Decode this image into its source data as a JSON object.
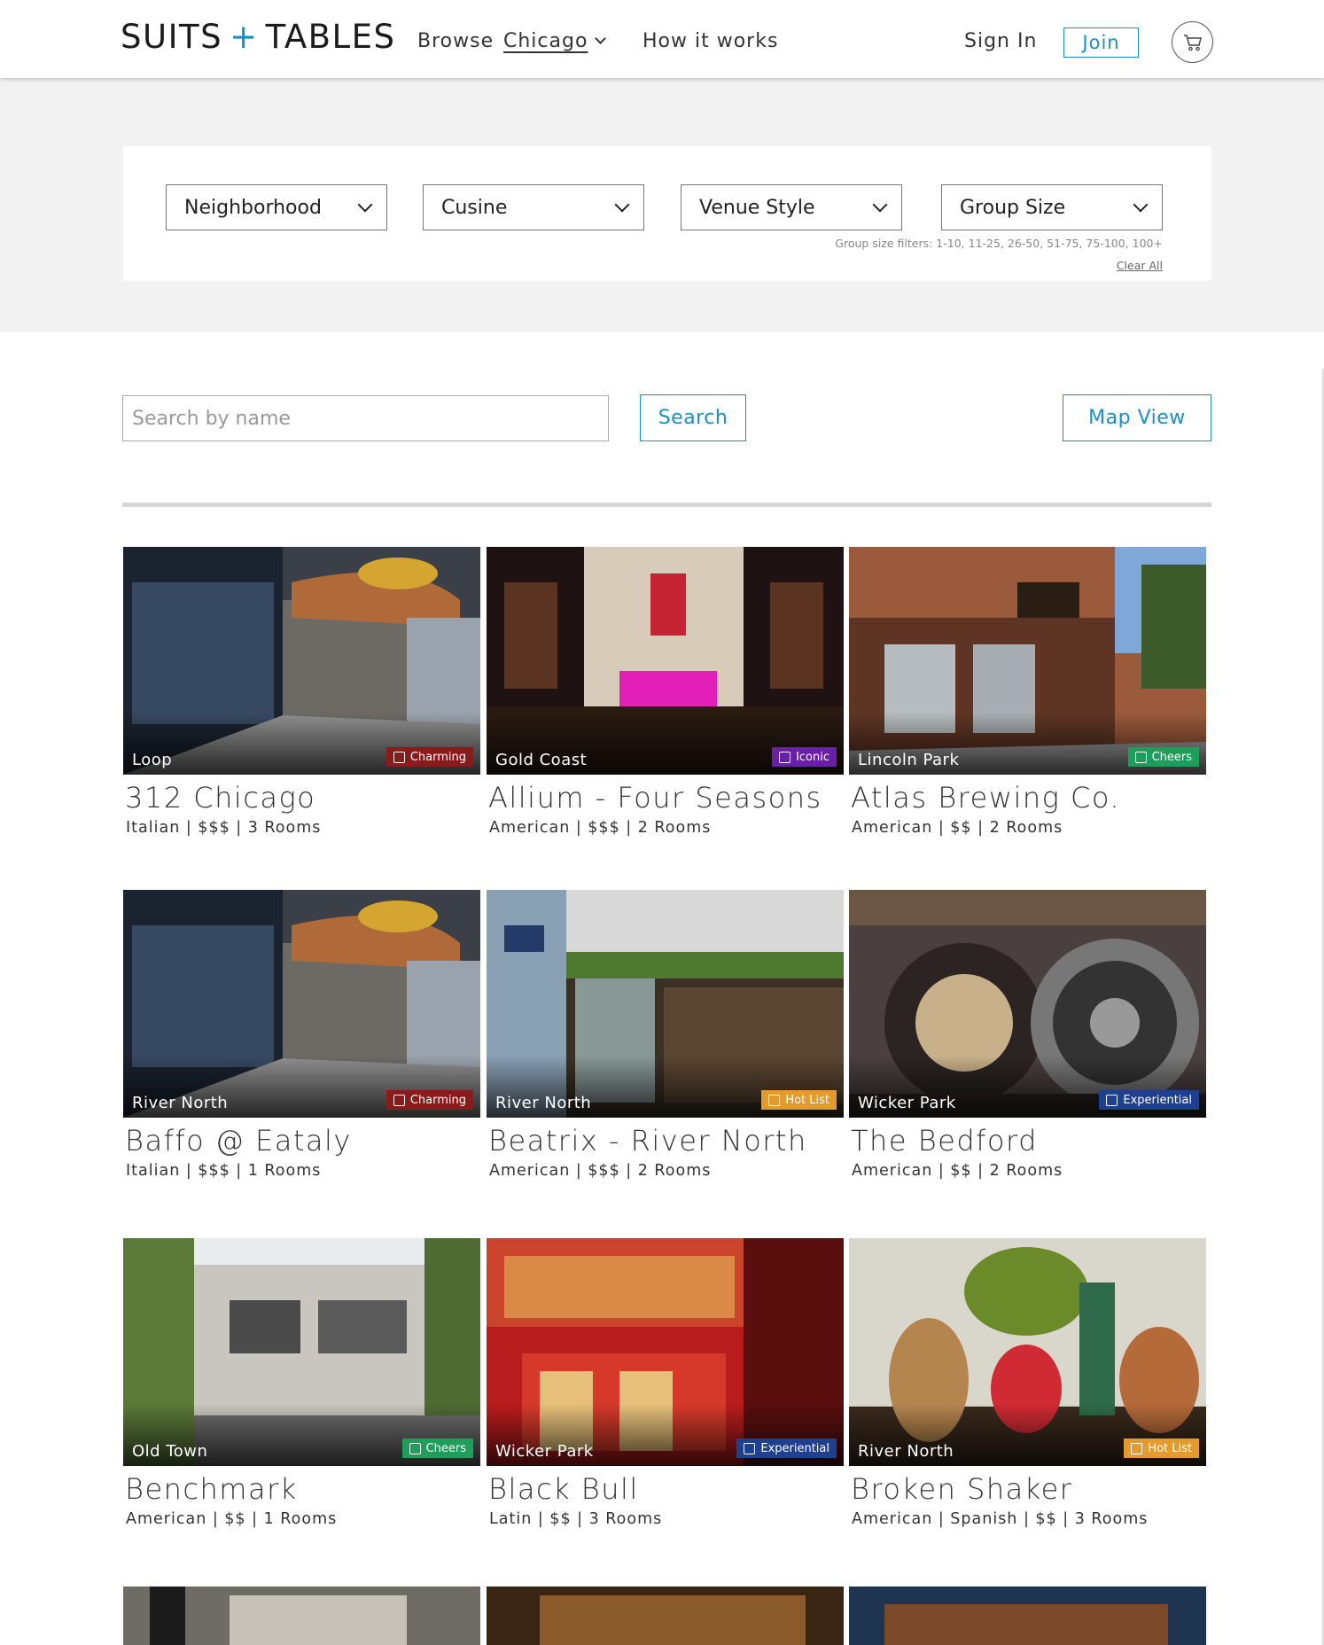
{
  "header": {
    "logo_left": "SUITS",
    "logo_plus": "+",
    "logo_right": "TABLES",
    "browse": "Browse",
    "city": "Chicago",
    "how_it_works": "How it works",
    "sign_in": "Sign In",
    "join": "Join"
  },
  "filters": {
    "neighborhood": "Neighborhood",
    "cuisine": "Cusine",
    "venue_style": "Venue Style",
    "group_size": "Group Size",
    "group_note": "Group size filters: 1-10, 11-25, 26-50, 51-75, 75-100, 100+",
    "clear_all": "Clear All"
  },
  "search": {
    "placeholder": "Search by name",
    "button": "Search",
    "map_view": "Map View"
  },
  "colors": {
    "accent": "#1a8fc7",
    "charming": "#8b1a1a",
    "iconic": "#6a1fa8",
    "cheers": "#1f9e5b",
    "hot_list": "#e39b2e",
    "experiential": "#1f3f8f"
  },
  "venues": [
    {
      "neighborhood": "Loop",
      "tag": "Charming",
      "tag_icon": "fork-icon",
      "name": "312 Chicago",
      "meta": "Italian | $$$ | 3 Rooms"
    },
    {
      "neighborhood": "Gold Coast",
      "tag": "Iconic",
      "tag_icon": "tower-icon",
      "name": "Allium - Four Seasons",
      "meta": "American | $$$ | 2 Rooms"
    },
    {
      "neighborhood": "Lincoln Park",
      "tag": "Cheers",
      "tag_icon": "glasses-icon",
      "name": "Atlas Brewing Co.",
      "meta": "American | $$ | 2 Rooms"
    },
    {
      "neighborhood": "River North",
      "tag": "Charming",
      "tag_icon": "fork-icon",
      "name": "Baffo @ Eataly",
      "meta": "Italian | $$$ | 1 Rooms"
    },
    {
      "neighborhood": "River North",
      "tag": "Hot List",
      "tag_icon": "flame-icon",
      "name": "Beatrix - River North",
      "meta": "American | $$$ | 2 Rooms"
    },
    {
      "neighborhood": "Wicker Park",
      "tag": "Experiential",
      "tag_icon": "sparkle-icon",
      "name": "The Bedford",
      "meta": "American | $$ | 2 Rooms"
    },
    {
      "neighborhood": "Old Town",
      "tag": "Cheers",
      "tag_icon": "glasses-icon",
      "name": "Benchmark",
      "meta": "American | $$ | 1 Rooms"
    },
    {
      "neighborhood": "Wicker Park",
      "tag": "Experiential",
      "tag_icon": "sparkle-icon",
      "name": "Black Bull",
      "meta": "Latin | $$ | 3 Rooms"
    },
    {
      "neighborhood": "River North",
      "tag": "Hot List",
      "tag_icon": "flame-icon",
      "name": "Broken Shaker",
      "meta": "American | Spanish | $$ | 3 Rooms"
    }
  ]
}
